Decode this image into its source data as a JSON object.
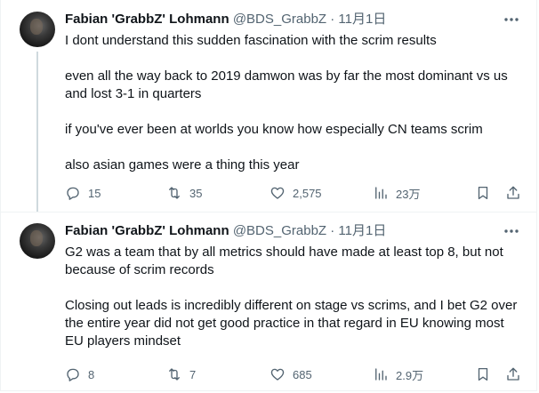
{
  "tweets": [
    {
      "author": {
        "display_name": "Fabian 'GrabbZ' Lohmann",
        "handle": "@BDS_GrabbZ"
      },
      "separator": "·",
      "date": "11月1日",
      "more_icon": "more-horizontal-icon",
      "paragraphs": [
        "I dont understand this sudden fascination with the scrim results",
        "even all the way back to 2019 damwon was by far the most dominant vs us and lost 3-1 in quarters",
        "if you've ever been at worlds you know how especially CN teams scrim",
        "also asian games were a thing this year"
      ],
      "actions": {
        "replies": "15",
        "retweets": "35",
        "likes": "2,575",
        "views": "23万"
      }
    },
    {
      "author": {
        "display_name": "Fabian 'GrabbZ' Lohmann",
        "handle": "@BDS_GrabbZ"
      },
      "separator": "·",
      "date": "11月1日",
      "more_icon": "more-horizontal-icon",
      "paragraphs": [
        "G2 was a team that by all metrics should have made at least top 8, but not because of scrim records",
        "Closing out leads is incredibly different on stage vs scrims, and I bet G2 over the entire year did not get good practice in that regard in EU knowing most EU players mindset"
      ],
      "actions": {
        "replies": "8",
        "retweets": "7",
        "likes": "685",
        "views": "2.9万"
      }
    }
  ],
  "colors": {
    "text": "#0f1419",
    "secondary": "#536471",
    "border": "#eff3f4",
    "thread_line": "#cfd9de"
  }
}
